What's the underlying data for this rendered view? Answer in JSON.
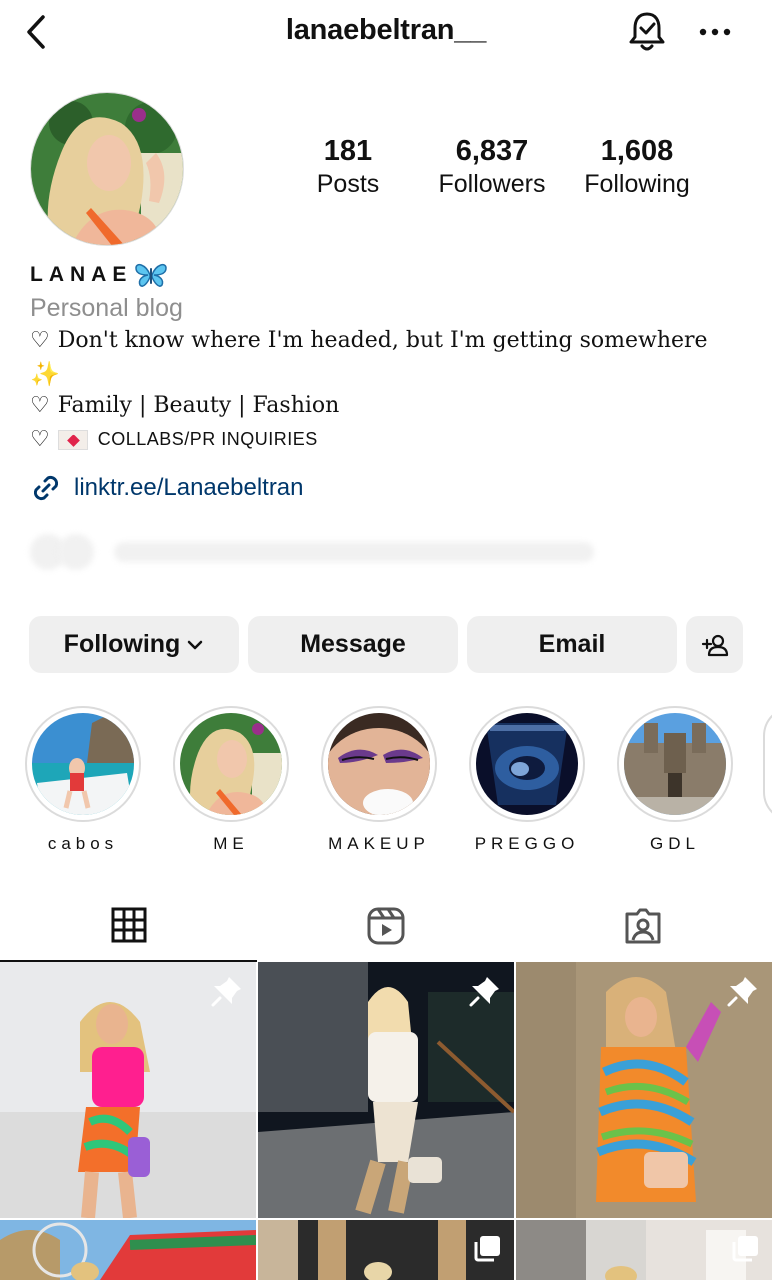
{
  "header": {
    "username": "lanaebeltran__",
    "back_icon": "chevron-left-icon",
    "notification_icon": "bell-check-icon",
    "more_icon": "more-horizontal-icon"
  },
  "profile": {
    "display_name": "LANAE",
    "category": "Personal blog",
    "bio": {
      "line1": "Don't know where I'm headed, but I'm getting somewhere",
      "line1_emoji": "✨",
      "line2": "Family | Beauty | Fashion",
      "line3": "COLLABS/PR INQUIRIES"
    },
    "link": "linktr.ee/Lanaebeltran"
  },
  "stats": {
    "posts_count": "181",
    "posts_label": "Posts",
    "followers_count": "6,837",
    "followers_label": "Followers",
    "following_count": "1,608",
    "following_label": "Following"
  },
  "actions": {
    "following": "Following",
    "message": "Message",
    "email": "Email"
  },
  "highlights": [
    {
      "label": "cabos"
    },
    {
      "label": "ME"
    },
    {
      "label": "MAKEUP"
    },
    {
      "label": "PREGGO"
    },
    {
      "label": "GDL"
    }
  ],
  "tabs": [
    "grid-icon",
    "reels-icon",
    "tagged-icon"
  ],
  "colors": {
    "link": "#00376b",
    "button_bg": "#efefef",
    "muted": "#8e8e8e"
  }
}
